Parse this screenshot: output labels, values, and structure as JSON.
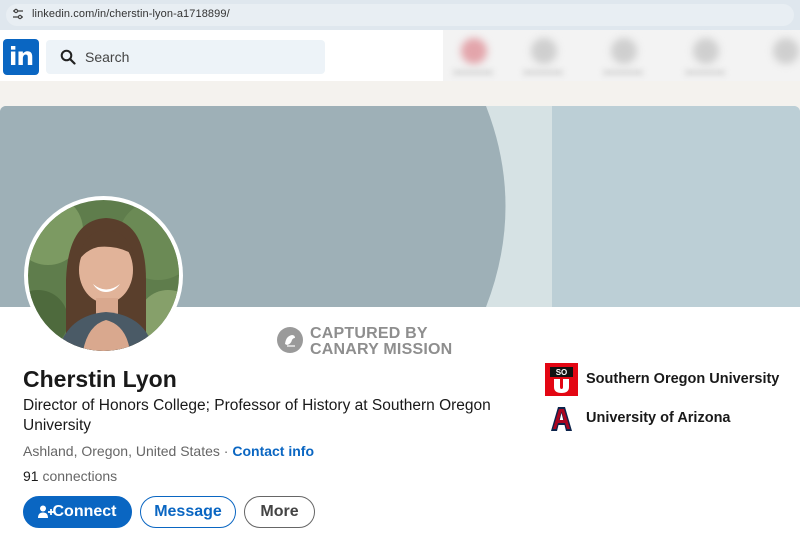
{
  "browser": {
    "url": "linkedin.com/in/cherstin-lyon-a1718899/"
  },
  "nav": {
    "logo_text": "in",
    "search_placeholder": "Search"
  },
  "watermark": {
    "line1": "CAPTURED BY",
    "line2": "CANARY MISSION"
  },
  "profile": {
    "name": "Cherstin Lyon",
    "headline": "Director of Honors College; Professor of History at Southern Oregon University",
    "location": "Ashland, Oregon, United States",
    "separator": " · ",
    "contact_info": "Contact info",
    "connections_count": "91",
    "connections_label": " connections"
  },
  "actions": {
    "connect": "Connect",
    "message": "Message",
    "more": "More"
  },
  "education": [
    {
      "name": "Southern Oregon University",
      "logo_text": "SO"
    },
    {
      "name": "University of Arizona",
      "logo_text": "A"
    }
  ],
  "colors": {
    "brand": "#0a66c2",
    "banner": "#bccfd6",
    "banner_shape": "#9eb0b7",
    "sou_red": "#e30613",
    "ua_navy": "#0c234b",
    "ua_red": "#ab0520"
  },
  "icons": {
    "url_settings": "tune-icon",
    "search": "search-icon",
    "connect": "add-person-icon",
    "watermark": "canary-icon"
  }
}
